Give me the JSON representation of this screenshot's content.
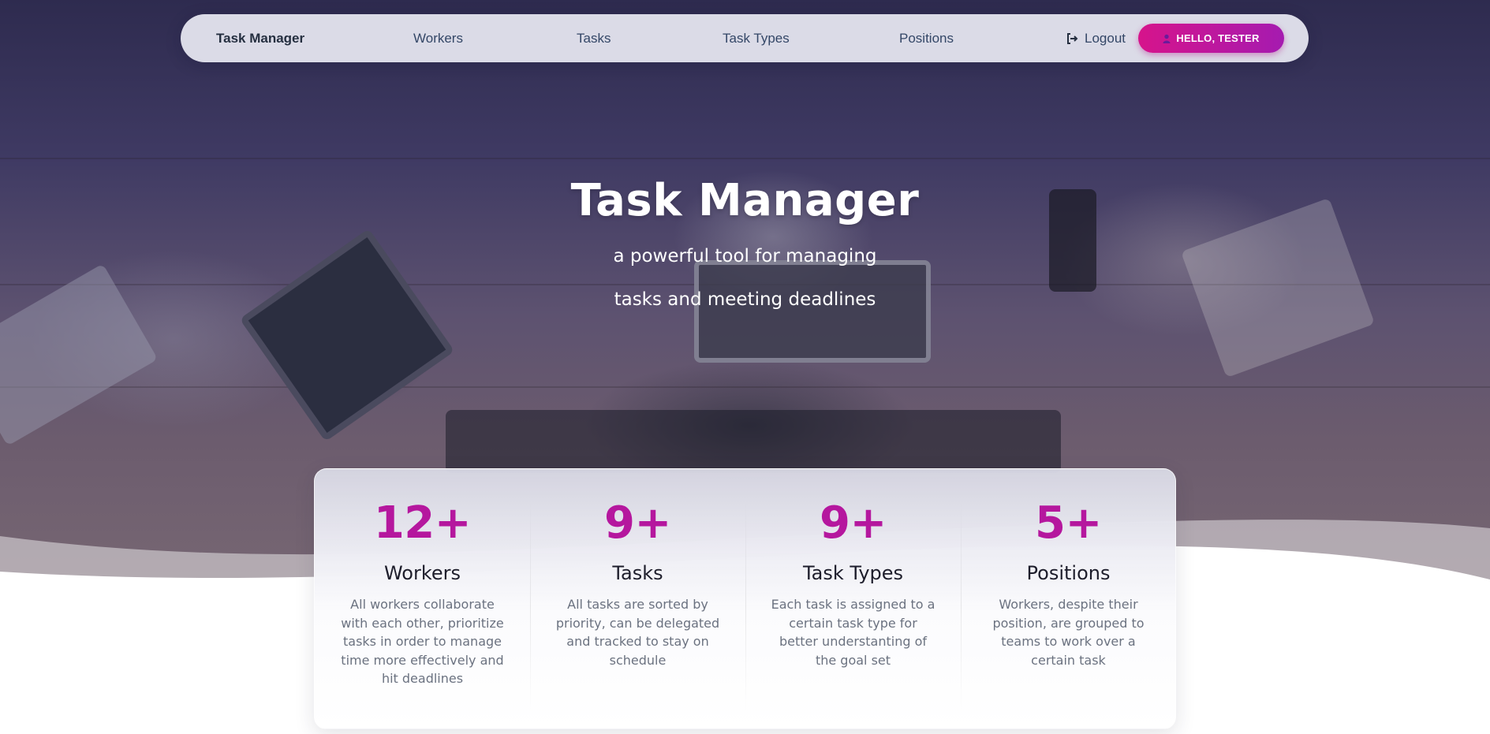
{
  "navbar": {
    "brand": "Task Manager",
    "links": [
      "Workers",
      "Tasks",
      "Task Types",
      "Positions"
    ],
    "logout_label": "Logout",
    "greeting": "HELLO, TESTER",
    "logout_icon": "sign-out-icon",
    "user_icon": "user-icon"
  },
  "hero": {
    "title": "Task Manager",
    "subtitle_line1": "a powerful tool for managing",
    "subtitle_line2": "tasks and meeting deadlines"
  },
  "stats": [
    {
      "value": "12+",
      "title": "Workers",
      "description": "All workers collaborate with each other, prioritize tasks in order to manage time more effectively and hit deadlines"
    },
    {
      "value": "9+",
      "title": "Tasks",
      "description": "All tasks are sorted by priority, can be delegated and tracked to stay on schedule"
    },
    {
      "value": "9+",
      "title": "Task Types",
      "description": "Each task is assigned to a certain task type for better understanting of the goal set"
    },
    {
      "value": "5+",
      "title": "Positions",
      "description": "Workers, despite their position, are grouped to teams to work over a certain task"
    }
  ],
  "colors": {
    "accent": "#b5179e",
    "button_gradient_start": "#d6148b",
    "button_gradient_end": "#a51bb0",
    "hero_overlay": "#3f3a63",
    "nav_text": "#344767"
  }
}
